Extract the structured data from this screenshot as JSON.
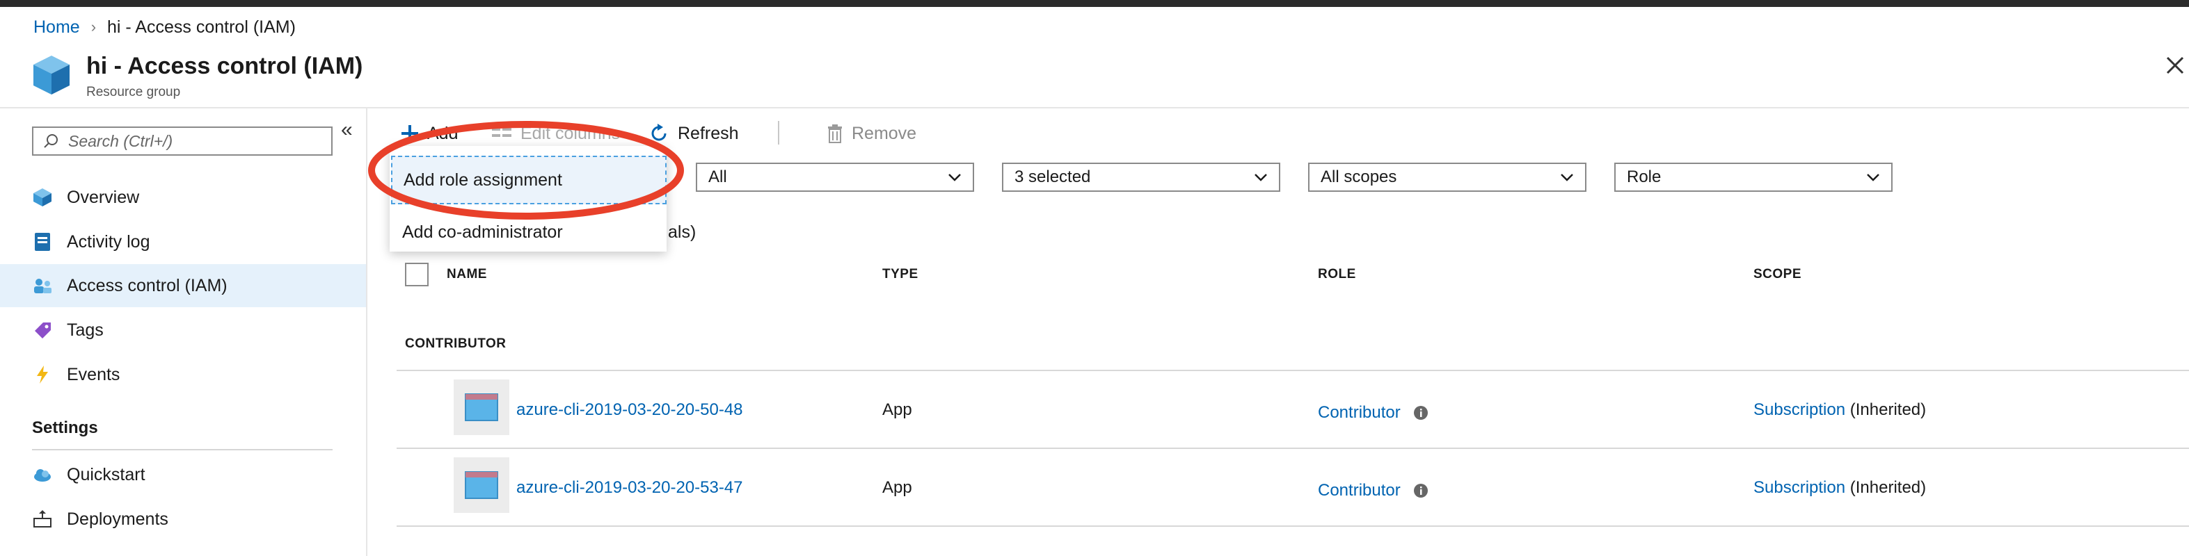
{
  "breadcrumb": {
    "home": "Home",
    "separator": "›",
    "current": "hi - Access control (IAM)"
  },
  "header": {
    "title": "hi - Access control (IAM)",
    "subtitle": "Resource group"
  },
  "search": {
    "placeholder": "Search (Ctrl+/)"
  },
  "sidebar": {
    "collapse_glyph": "«",
    "items": [
      {
        "label": "Overview",
        "icon": "overview-icon"
      },
      {
        "label": "Activity log",
        "icon": "activity-log-icon"
      },
      {
        "label": "Access control (IAM)",
        "icon": "iam-icon",
        "active": true
      },
      {
        "label": "Tags",
        "icon": "tag-icon"
      },
      {
        "label": "Events",
        "icon": "lightning-icon"
      }
    ],
    "settings_heading": "Settings",
    "settings_items": [
      {
        "label": "Quickstart",
        "icon": "cloud-icon"
      },
      {
        "label": "Deployments",
        "icon": "deployments-icon"
      }
    ]
  },
  "toolbar": {
    "add": "Add",
    "edit_columns": "Edit columns",
    "refresh": "Refresh",
    "remove": "Remove"
  },
  "filters": [
    "All",
    "3 selected",
    "All scopes",
    "Role"
  ],
  "results_text": "als)",
  "table": {
    "columns": [
      "NAME",
      "TYPE",
      "ROLE",
      "SCOPE"
    ],
    "group": "CONTRIBUTOR",
    "rows": [
      {
        "name": "azure-cli-2019-03-20-20-50-48",
        "type": "App",
        "role": "Contributor",
        "scope_link": "Subscription",
        "scope_suffix": " (Inherited)"
      },
      {
        "name": "azure-cli-2019-03-20-20-53-47",
        "type": "App",
        "role": "Contributor",
        "scope_link": "Subscription",
        "scope_suffix": " (Inherited)"
      }
    ]
  },
  "add_menu": {
    "items": [
      "Add role assignment",
      "Add co-administrator"
    ]
  },
  "colors": {
    "link": "#0063b1",
    "active_nav": "#e5f1fb",
    "annotation": "#e8402a"
  }
}
